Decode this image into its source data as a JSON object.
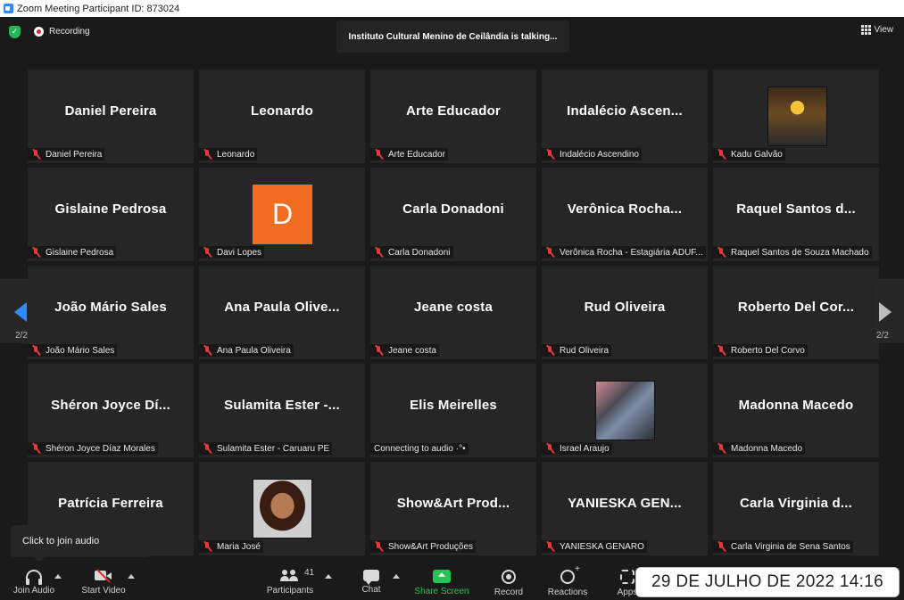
{
  "window": {
    "title": "Zoom Meeting Participant ID: 873024"
  },
  "topbar": {
    "recording_label": "Recording",
    "talking_text": "Instituto Cultural Menino de Ceilândia is talking...",
    "view_label": "View"
  },
  "tiles": [
    {
      "big": "Daniel Pereira",
      "label": "Daniel Pereira"
    },
    {
      "big": "Leonardo",
      "label": "Leonardo"
    },
    {
      "big": "Arte Educador",
      "label": "Arte Educador"
    },
    {
      "big": "Indalécio  Ascen...",
      "label": "Indalécio Ascendino"
    },
    {
      "big": "",
      "label": "Kadu Galvão"
    },
    {
      "big": "Gislaine Pedrosa",
      "label": "Gislaine Pedrosa"
    },
    {
      "big": "",
      "label": "Davi Lopes",
      "avatar_letter": "D"
    },
    {
      "big": "Carla Donadoni",
      "label": "Carla Donadoni"
    },
    {
      "big": "Verônica  Rocha...",
      "label": "Verônica Rocha - Estagiária ADUF..."
    },
    {
      "big": "Raquel  Santos  d...",
      "label": "Raquel Santos de Souza Machado"
    },
    {
      "big": "João Mário Sales",
      "label": "João Mário Sales"
    },
    {
      "big": "Ana  Paula  Olive...",
      "label": "Ana Paula Oliveira"
    },
    {
      "big": "Jeane costa",
      "label": "Jeane costa"
    },
    {
      "big": "Rud Oliveira",
      "label": "Rud Oliveira"
    },
    {
      "big": "Roberto  Del  Cor...",
      "label": "Roberto Del Corvo"
    },
    {
      "big": "Shéron  Joyce  Dí...",
      "label": "Shéron Joyce Díaz Morales"
    },
    {
      "big": "Sulamita  Ester  -...",
      "label": "Sulamita Ester - Caruaru PE"
    },
    {
      "big": "Elis Meirelles",
      "label": "Connecting to audio ·°•"
    },
    {
      "big": "",
      "label": "Israel Araujo"
    },
    {
      "big": "Madonna Macedo",
      "label": "Madonna Macedo"
    },
    {
      "big": "Patrícia Ferreira",
      "label": ""
    },
    {
      "big": "",
      "label": "Maria José"
    },
    {
      "big": "Show&Art  Prod...",
      "label": "Show&Art Produções"
    },
    {
      "big": "YANIESKA  GEN...",
      "label": "YANIESKA GENARO"
    },
    {
      "big": "Carla  Virginia  d...",
      "label": "Carla Virginia de Sena Santos"
    }
  ],
  "pager": {
    "left": "2/2",
    "right": "2/2"
  },
  "tooltip": {
    "text": "Click to join audio"
  },
  "toolbar": {
    "join_audio": "Join Audio",
    "start_video": "Start Video",
    "participants": "Participants",
    "participants_count": "41",
    "chat": "Chat",
    "share_screen": "Share Screen",
    "record": "Record",
    "reactions": "Reactions",
    "apps": "Apps"
  },
  "timestamp": "29 DE JULHO DE 2022 14:16",
  "colors": {
    "share_green": "#23c552",
    "mute_red": "#e03b3b",
    "avatar_orange": "#f26d21",
    "arrow_blue": "#2d8cff"
  }
}
